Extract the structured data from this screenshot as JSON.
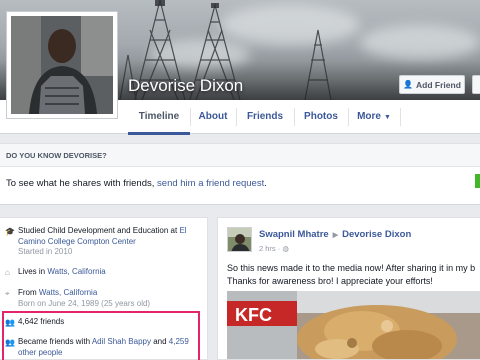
{
  "profile": {
    "name": "Devorise Dixon"
  },
  "actions": {
    "add_friend_label": "Add Friend"
  },
  "nav": {
    "tabs": [
      {
        "label": "Timeline",
        "active": true
      },
      {
        "label": "About"
      },
      {
        "label": "Friends"
      },
      {
        "label": "Photos"
      },
      {
        "label": "More"
      }
    ]
  },
  "know_box": {
    "heading": "DO YOU KNOW DEVORISE?",
    "text_prefix": "To see what he shares with friends, ",
    "link": "send him a friend request",
    "text_suffix": "."
  },
  "about": {
    "education": {
      "prefix": "Studied Child Development and Education at ",
      "link": "El Camino College Compton Center",
      "sub": "Started in 2010"
    },
    "lives": {
      "prefix": "Lives in ",
      "link": "Watts, California"
    },
    "from": {
      "prefix": "From ",
      "link": "Watts, California",
      "sub": "Born on June 24, 1989 (25 years old)"
    },
    "friends_count": "4,642 friends",
    "became_friends": {
      "prefix": "Became friends with ",
      "link1": "Adil Shah Bappy",
      "middle": " and ",
      "link2": "4,259 other people"
    }
  },
  "post": {
    "author": "Swapnil Mhatre",
    "target": "Devorise Dixon",
    "time": "2 hrs · ",
    "line1": "So this news made it to the media now! After sharing it in my b",
    "line2": "Thanks for awareness bro! I appreciate your efforts!",
    "image_text": "KFC"
  },
  "colors": {
    "link": "#3b5998",
    "highlight": "#e3246b",
    "green": "#42b72a"
  }
}
